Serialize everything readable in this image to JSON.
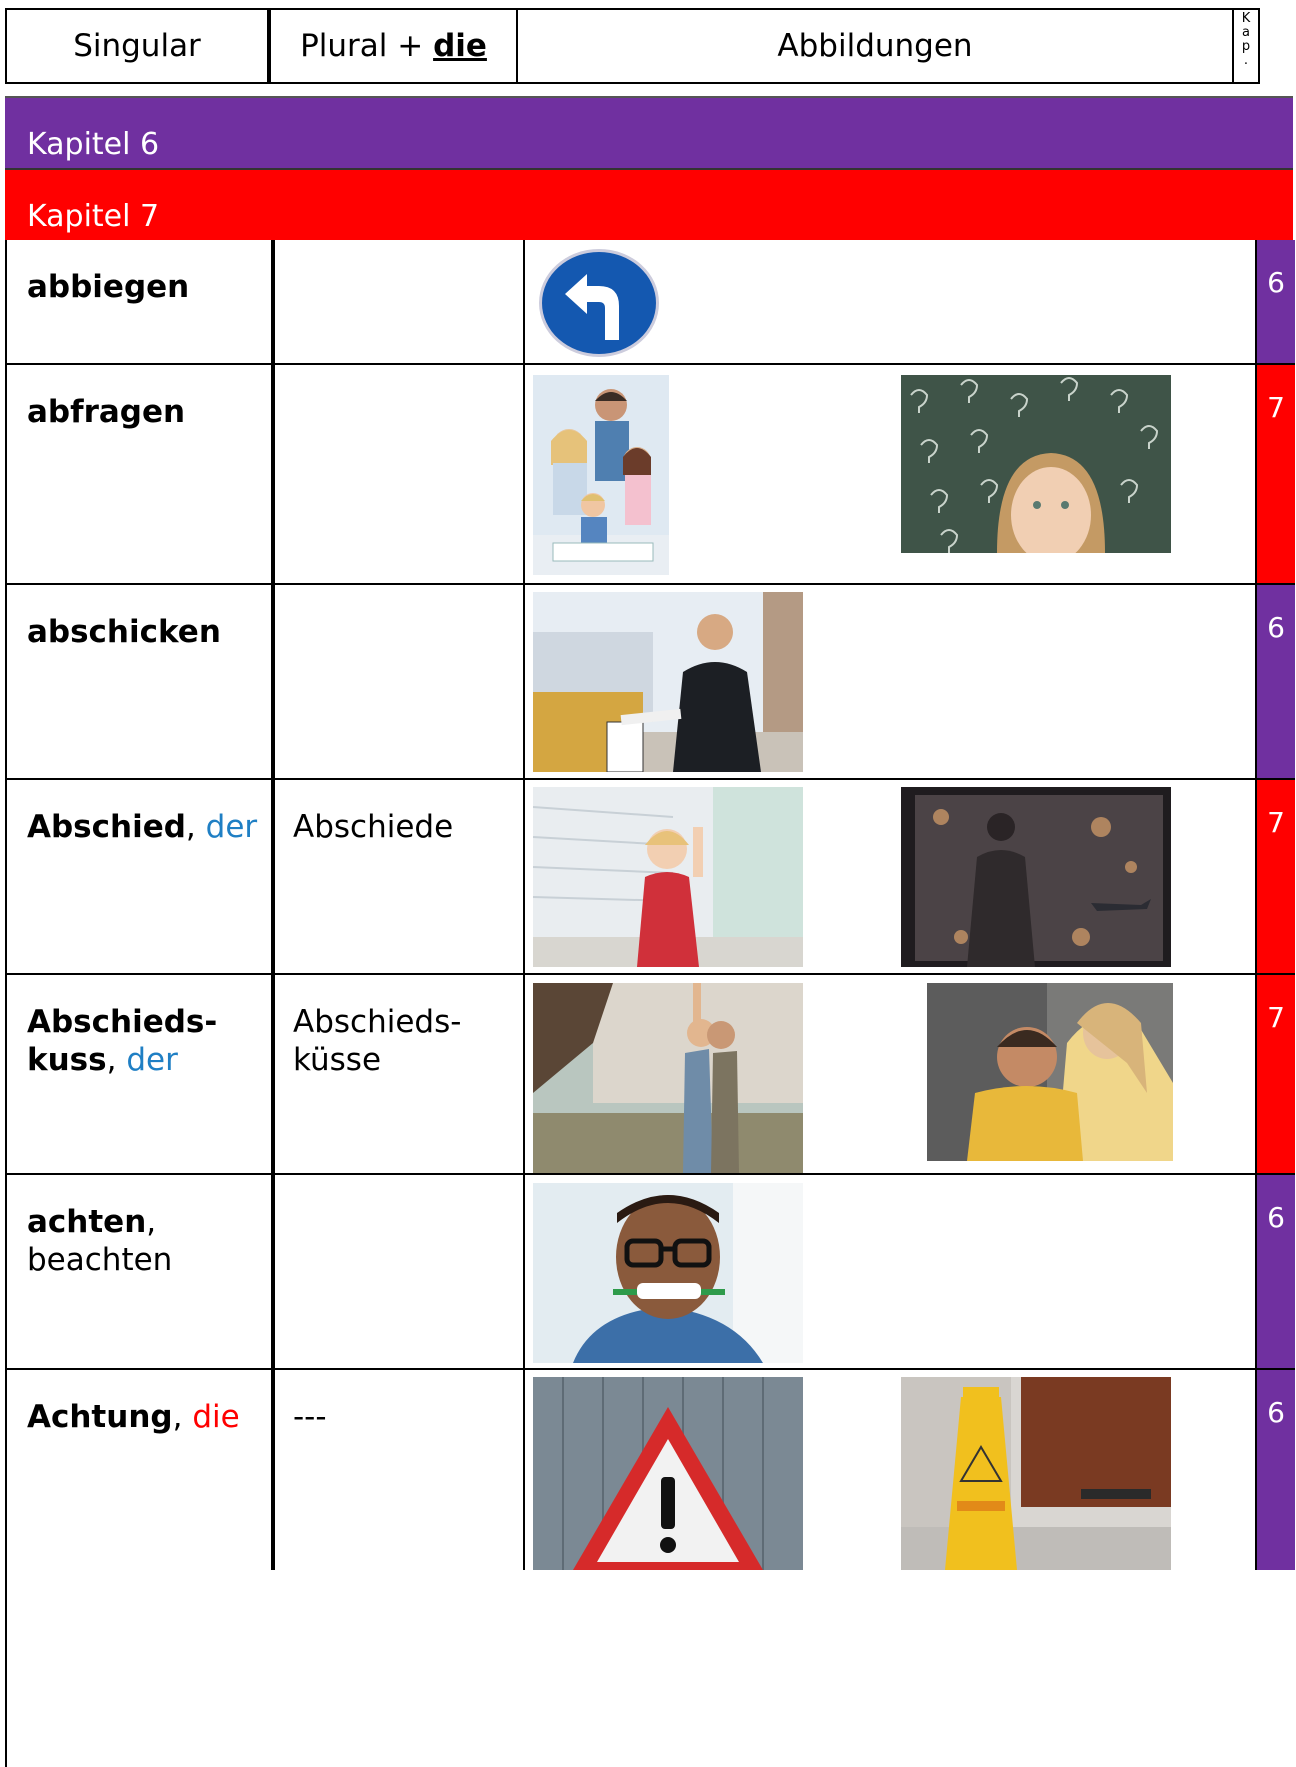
{
  "header": {
    "singular": "Singular",
    "plural_prefix": "Plural + ",
    "plural_die": "die",
    "abbildungen": "Abbildungen",
    "kap": [
      "K",
      "a",
      "p",
      "."
    ]
  },
  "chapters": {
    "k6": "Kapitel 6",
    "k7": "Kapitel 7"
  },
  "rows": [
    {
      "singular": "abbiegen",
      "plural": "",
      "kap": "6",
      "images": [
        "turn-left-sign-icon"
      ]
    },
    {
      "singular": "abfragen",
      "plural": "",
      "kap": "7",
      "images": [
        "family-photo",
        "question-marks-woman-photo"
      ]
    },
    {
      "singular": "abschicken",
      "plural": "",
      "kap": "6",
      "images": [
        "man-mailbox-photo"
      ]
    },
    {
      "singular": "Abschied",
      "article": "der",
      "plural": "Abschiede",
      "kap": "7",
      "images": [
        "girl-waving-photo",
        "woman-window-airplane-photo"
      ]
    },
    {
      "singular": "Abschieds-",
      "singular2": "kuss",
      "article": "der",
      "plural": "Abschieds-",
      "plural2": "küsse",
      "kap": "7",
      "images": [
        "couple-kiss-photo",
        "mother-kiss-child-photo"
      ]
    },
    {
      "singular": "achten",
      "singular_extra": "beachten",
      "plural": "",
      "kap": "6",
      "images": [
        "man-glasses-pencil-photo"
      ]
    },
    {
      "singular": "Achtung",
      "article": "die",
      "plural": "---",
      "kap": "6",
      "images": [
        "warning-sign-photo",
        "wet-floor-sign-photo"
      ]
    }
  ],
  "colors": {
    "kap6": "#7030a0",
    "kap7": "#ff0000",
    "der": "#1f7fc4",
    "die": "#ff0000"
  }
}
